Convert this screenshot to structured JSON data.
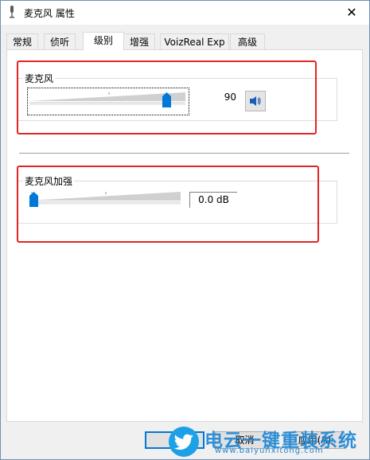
{
  "window": {
    "title": "麦克风 属性",
    "close_glyph": "✕"
  },
  "tabs": [
    "常规",
    "侦听",
    "级别",
    "增强",
    "VoizReal Exp",
    "高级"
  ],
  "active_tab": "级别",
  "mic_group": {
    "label": "麦克风",
    "value": "90",
    "level": 0.9,
    "mute_icon": "speaker-icon"
  },
  "boost_group": {
    "label": "麦克风加强",
    "value": "0.0 dB",
    "level": 0.0
  },
  "buttons": {
    "cancel": "取消",
    "apply": "应用(A)"
  },
  "watermark": {
    "title": "电云一键重装系统",
    "url": "www.baiyunxitong.com"
  },
  "colors": {
    "accent": "#0078d7",
    "highlight": "#e32424"
  }
}
